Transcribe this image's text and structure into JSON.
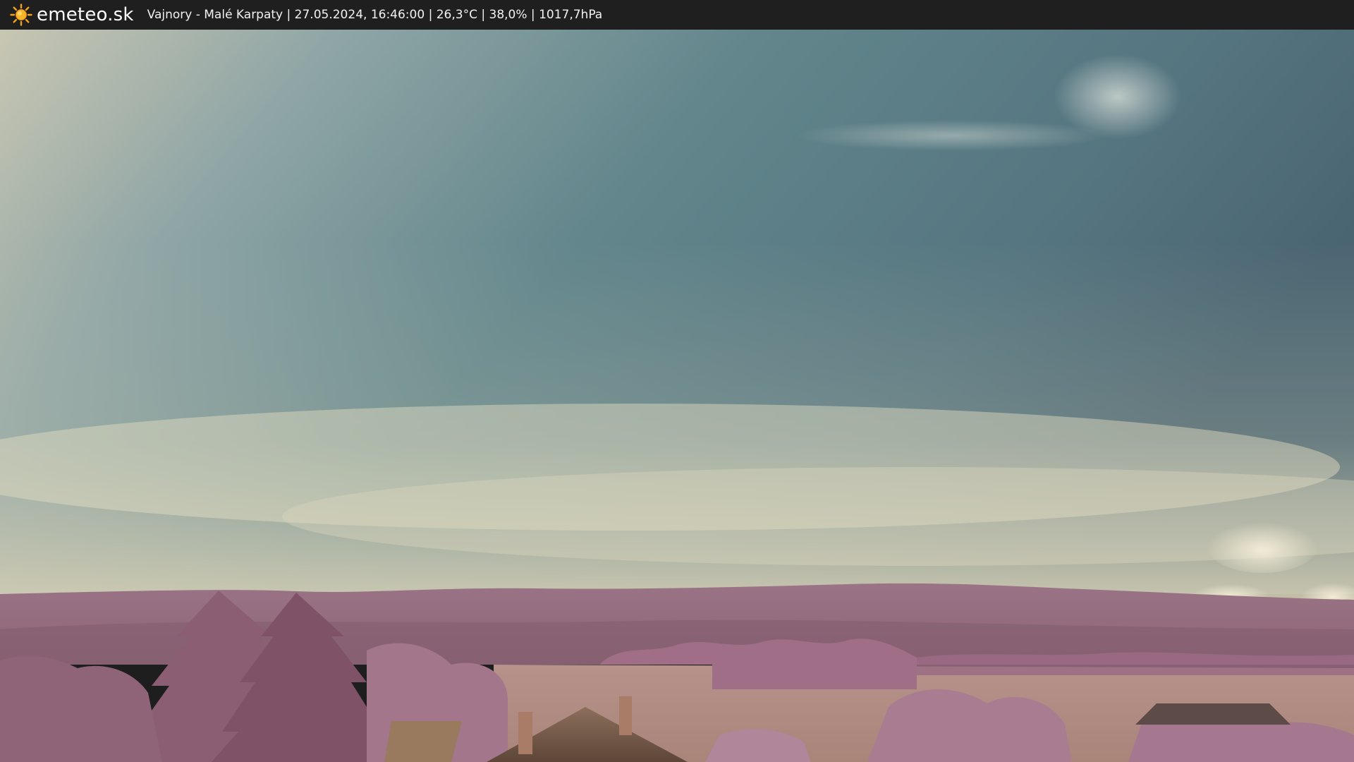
{
  "header": {
    "brand": "emeteo.sk",
    "logo_icon": "sun-icon",
    "location": "Vajnory - Malé Karpaty",
    "datetime": "27.05.2024, 16:46:00",
    "temperature": "26,3°C",
    "humidity": "38,0%",
    "pressure": "1017,7hPa",
    "separator": " | "
  },
  "colors": {
    "bar_background": "#1f1f1f",
    "sun_accent": "#f5a31a",
    "sky_top": "#4b6f7c",
    "sky_haze": "#e9e2c4",
    "foliage": "#a8738c",
    "field": "#b8918a"
  }
}
